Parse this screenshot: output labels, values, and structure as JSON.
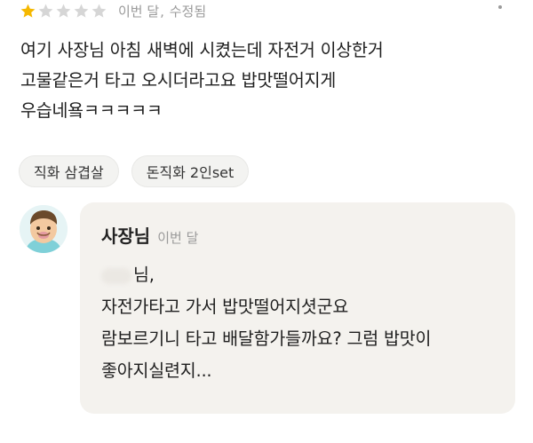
{
  "review": {
    "rating": 1,
    "rating_max": 5,
    "colors": {
      "star_filled": "#f5b800",
      "star_empty": "#d6d6d6"
    },
    "date": "이번 달",
    "edited": "수정됨",
    "separator": ",",
    "more_icon": "more-dots-icon",
    "lines": [
      "여기 사장님 아침 새벽에 시켰는데 자전거 이상한거",
      "고물같은거 타고 오시더라고요 밥맛떨어지게",
      "우습네욬ㅋㅋㅋㅋㅋ"
    ],
    "tags": [
      "직화 삼겹살",
      "돈직화 2인set"
    ]
  },
  "reply": {
    "avatar_icon": "owner-avatar-icon",
    "owner_name": "사장님",
    "date": "이번 달",
    "greeting": "님,",
    "lines": [
      "자전가타고 가서 밥맛떨어지셧군요",
      "람보르기니 타고 배달함가들까요? 그럼 밥맛이",
      "좋아지실련지..."
    ]
  }
}
